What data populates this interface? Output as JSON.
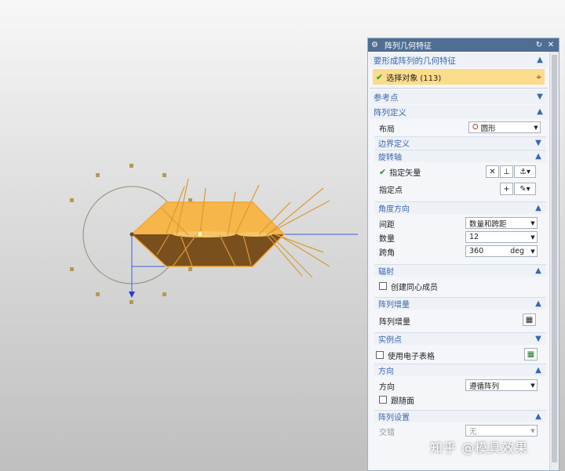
{
  "dialog": {
    "title": "阵列几何特征",
    "sections": {
      "geometry": {
        "label": "要形成阵列的几何特征",
        "select_label": "选择对象 (113)"
      },
      "reference": {
        "label": "参考点"
      },
      "definition": {
        "label": "阵列定义"
      }
    },
    "layout": {
      "label": "布局",
      "value": "圆形"
    },
    "boundary": {
      "label": "边界定义"
    },
    "rotation_axis": {
      "label": "旋转轴",
      "vector_label": "指定矢量",
      "point_label": "指定点"
    },
    "angle": {
      "label": "角度方向",
      "spacing_label": "间距",
      "spacing_value": "数量和跨距",
      "count_label": "数量",
      "count_value": "12",
      "span_label": "跨角",
      "span_value": "360",
      "span_unit": "deg"
    },
    "radiate": {
      "label": "辐射",
      "concentric_label": "创建同心成员"
    },
    "increment": {
      "label": "阵列增量",
      "row_label": "阵列增量"
    },
    "instance": {
      "label": "实例点",
      "spreadsheet_label": "使用电子表格"
    },
    "orientation": {
      "label": "方向",
      "dir_label": "方向",
      "dir_value": "遵循阵列",
      "follow_label": "跟随面"
    },
    "settings": {
      "label": "阵列设置",
      "stagger_label": "交错",
      "stagger_value": "无"
    }
  },
  "watermark": "知乎 @模具效果",
  "colors": {
    "titlebar": "#4f6e93",
    "section_text": "#3a67b0",
    "selection": "#fbdc8a",
    "part_top": "#f6b64a",
    "part_bottom": "#8a5a20"
  }
}
